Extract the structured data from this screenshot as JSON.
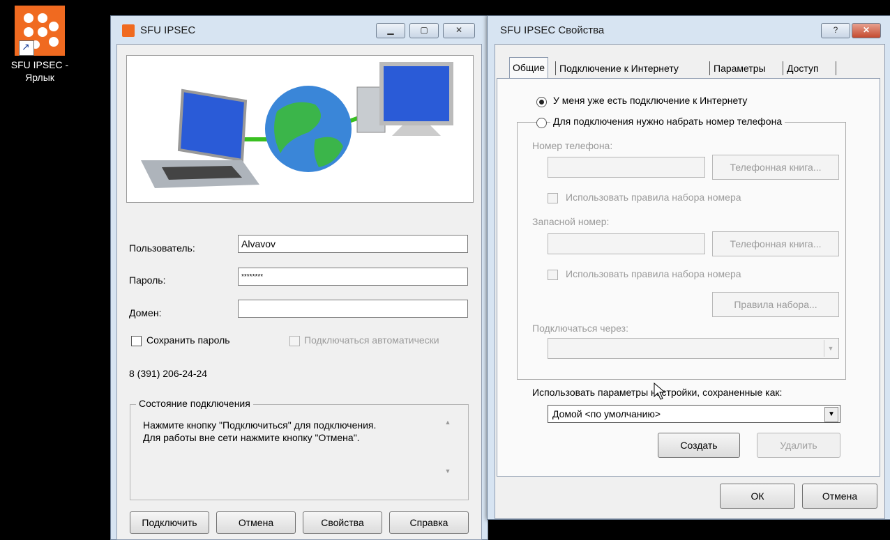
{
  "desktop": {
    "shortcut_label": "SFU IPSEC -\nЯрлык"
  },
  "login_window": {
    "title": "SFU IPSEC",
    "user_label": "Пользователь:",
    "user_value": "Alvavov",
    "password_label": "Пароль:",
    "password_value": "********",
    "domain_label": "Домен:",
    "domain_value": "",
    "save_password_label": "Сохранить пароль",
    "auto_connect_label": "Подключаться автоматически",
    "phone_number": "8 (391) 206-24-24",
    "status_group_title": "Состояние подключения",
    "status_text": "Нажмите кнопку \"Подключиться\" для подключения.\nДля работы вне сети нажмите кнопку \"Отмена\".",
    "buttons": {
      "connect": "Подключить",
      "cancel": "Отмена",
      "properties": "Свойства",
      "help": "Справка"
    }
  },
  "properties_window": {
    "title": "SFU IPSEC Свойства",
    "help_caption": "?",
    "tabs": [
      "Общие",
      "Подключение к Интернету",
      "Параметры",
      "Доступ"
    ],
    "radio_have_connection": "У меня уже есть подключение к Интернету",
    "radio_dial": "Для подключения нужно набрать номер телефона",
    "phone_label": "Номер телефона:",
    "phonebook_button": "Телефонная книга...",
    "use_dial_rules": "Использовать правила набора номера",
    "alt_phone_label": "Запасной номер:",
    "dial_rules_button": "Правила набора...",
    "connect_via_label": "Подключаться через:",
    "use_settings_label": "Использовать параметры настройки, сохраненные как:",
    "location_value": "Домой <по умолчанию>",
    "create_button": "Создать",
    "delete_button": "Удалить",
    "ok_button": "ОК",
    "cancel_button": "Отмена"
  }
}
